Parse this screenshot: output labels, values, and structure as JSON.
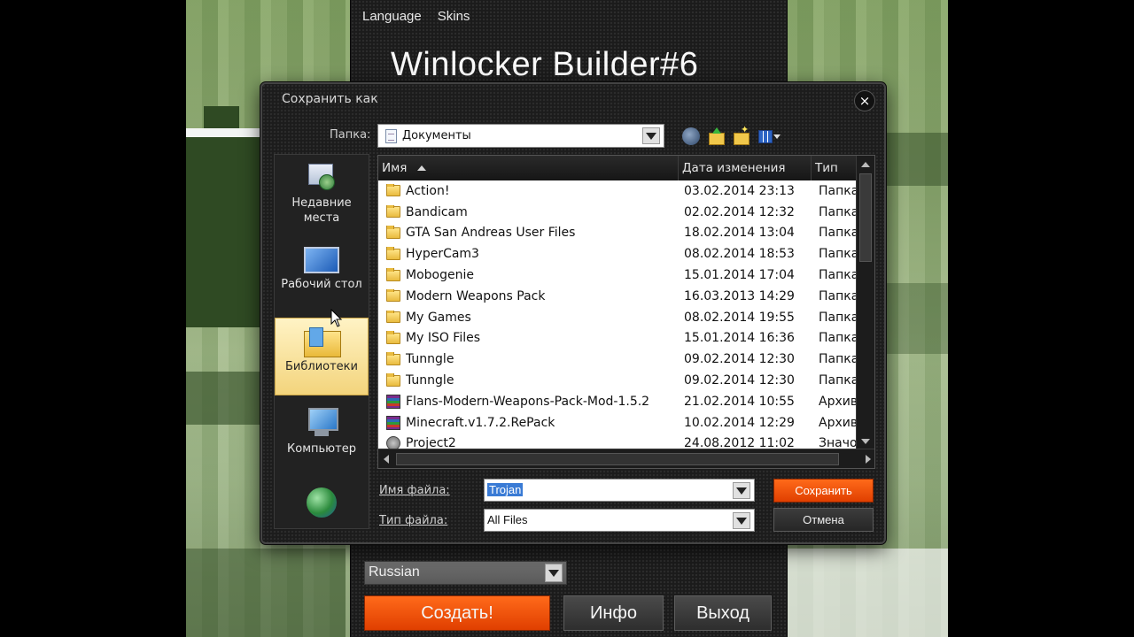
{
  "builder": {
    "menu": [
      "Language",
      "Skins"
    ],
    "title": "Winlocker Builder#6",
    "language_value": "Russian",
    "buttons": {
      "create": "Создать!",
      "info": "Инфо",
      "exit": "Выход"
    }
  },
  "dialog": {
    "title": "Сохранить как",
    "close": "×",
    "folder_label": "Папка:",
    "folder_value": "Документы",
    "places": [
      {
        "label": "Недавние места",
        "icon": "recent-places-icon"
      },
      {
        "label": "Рабочий стол",
        "icon": "desktop-icon"
      },
      {
        "label": "Библиотеки",
        "icon": "libraries-icon",
        "active": true
      },
      {
        "label": "Компьютер",
        "icon": "computer-icon"
      },
      {
        "label": "",
        "icon": "network-icon"
      }
    ],
    "columns": {
      "name": "Имя",
      "date": "Дата изменения",
      "type": "Тип"
    },
    "files": [
      {
        "name": "Action!",
        "date": "03.02.2014 23:13",
        "type": "Папка",
        "icon": "folder"
      },
      {
        "name": "Bandicam",
        "date": "02.02.2014 12:32",
        "type": "Папка",
        "icon": "folder"
      },
      {
        "name": "GTA San Andreas User Files",
        "date": "18.02.2014 13:04",
        "type": "Папка",
        "icon": "folder"
      },
      {
        "name": "HyperCam3",
        "date": "08.02.2014 18:53",
        "type": "Папка",
        "icon": "folder"
      },
      {
        "name": "Mobogenie",
        "date": "15.01.2014 17:04",
        "type": "Папка",
        "icon": "folder"
      },
      {
        "name": "Modern Weapons Pack",
        "date": "16.03.2013 14:29",
        "type": "Папка",
        "icon": "folder"
      },
      {
        "name": "My Games",
        "date": "08.02.2014 19:55",
        "type": "Папка",
        "icon": "folder"
      },
      {
        "name": "My ISO Files",
        "date": "15.01.2014 16:36",
        "type": "Папка",
        "icon": "folder"
      },
      {
        "name": "Tunngle",
        "date": "09.02.2014 12:30",
        "type": "Папка",
        "icon": "folder"
      },
      {
        "name": "Tunngle",
        "date": "09.02.2014 12:30",
        "type": "Папка",
        "icon": "folder"
      },
      {
        "name": "Flans-Modern-Weapons-Pack-Mod-1.5.2",
        "date": "21.02.2014 10:55",
        "type": "Архив",
        "icon": "archive"
      },
      {
        "name": "Minecraft.v1.7.2.RePack",
        "date": "10.02.2014 12:29",
        "type": "Архив",
        "icon": "archive"
      },
      {
        "name": "Project2",
        "date": "24.08.2012 11:02",
        "type": "Значо",
        "icon": "project"
      }
    ],
    "filename_label": "Имя файла:",
    "filename_value": "Trojan",
    "filetype_label": "Тип файла:",
    "filetype_value": "All Files",
    "save_button": "Сохранить",
    "cancel_button": "Отмена"
  },
  "colors": {
    "accent": "#f05a12",
    "dialog_bg": "#1c1c1c",
    "selection": "#3a7bd5"
  }
}
